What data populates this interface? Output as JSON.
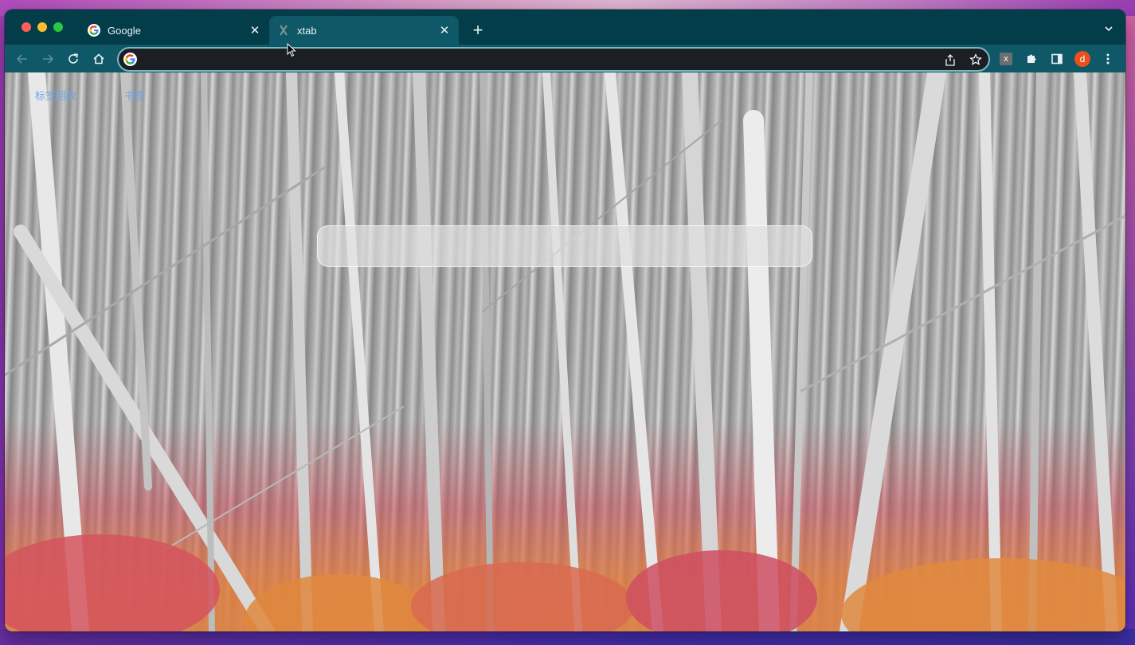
{
  "browser": {
    "tabs": [
      {
        "title": "Google",
        "favicon": "google-g-icon",
        "active": false
      },
      {
        "title": "xtab",
        "favicon": "x-icon",
        "active": true
      }
    ],
    "newtab_label": "+",
    "tab_close_glyph": "✕",
    "omnibox": {
      "value": "",
      "placeholder": ""
    },
    "extension_label": "x",
    "profile_initial": "d"
  },
  "page": {
    "links": [
      "标签回收",
      "书签"
    ],
    "search": {
      "value": "",
      "placeholder": ""
    }
  },
  "colors": {
    "frame": "#033d4a",
    "toolbar": "#0e5867",
    "link": "#6fa4e6",
    "avatar": "#e8501d"
  }
}
